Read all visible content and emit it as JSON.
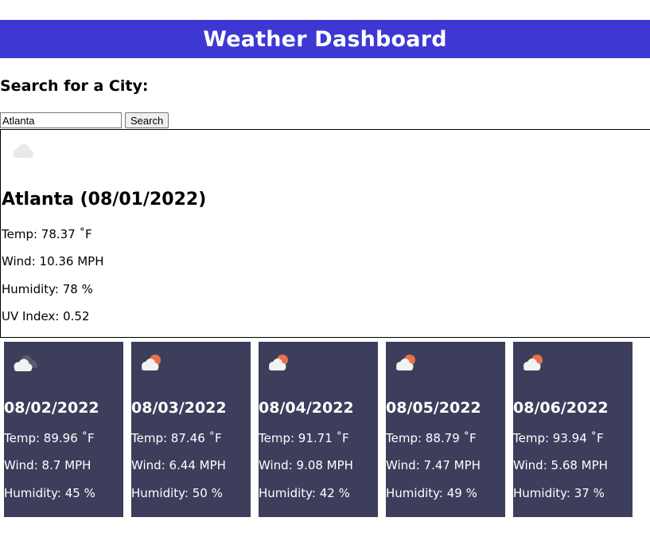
{
  "header": {
    "title": "Weather Dashboard"
  },
  "search": {
    "title": "Search for a City:",
    "input_value": "Atlanta",
    "button_label": "Search"
  },
  "current": {
    "icon": "cloud-icon",
    "city_date": "Atlanta (08/01/2022)",
    "temp": "Temp: 78.37 ˚F",
    "wind": "Wind: 10.36 MPH",
    "humidity": "Humidity: 78 %",
    "uv": "UV Index: 0.52"
  },
  "forecast": [
    {
      "icon": "broken-clouds-icon",
      "date": "08/02/2022",
      "temp": "Temp: 89.96 ˚F",
      "wind": "Wind: 8.7 MPH",
      "humidity": "Humidity: 45 %"
    },
    {
      "icon": "partly-cloudy-icon",
      "date": "08/03/2022",
      "temp": "Temp: 87.46 ˚F",
      "wind": "Wind: 6.44 MPH",
      "humidity": "Humidity: 50 %"
    },
    {
      "icon": "partly-cloudy-icon",
      "date": "08/04/2022",
      "temp": "Temp: 91.71 ˚F",
      "wind": "Wind: 9.08 MPH",
      "humidity": "Humidity: 42 %"
    },
    {
      "icon": "partly-cloudy-icon",
      "date": "08/05/2022",
      "temp": "Temp: 88.79 ˚F",
      "wind": "Wind: 7.47 MPH",
      "humidity": "Humidity: 49 %"
    },
    {
      "icon": "partly-cloudy-icon",
      "date": "08/06/2022",
      "temp": "Temp: 93.94 ˚F",
      "wind": "Wind: 5.68 MPH",
      "humidity": "Humidity: 37 %"
    }
  ],
  "colors": {
    "header_bg": "#3d38d3",
    "forecast_card_bg": "#3d3e5c",
    "sun": "#e8704e"
  }
}
